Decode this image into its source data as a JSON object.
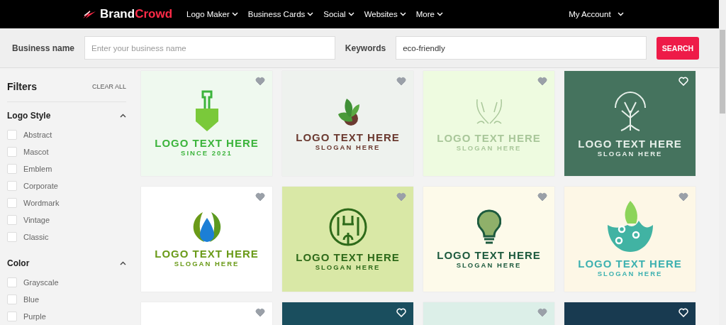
{
  "nav": {
    "brand": {
      "first": "Brand",
      "second": "Crowd"
    },
    "items": [
      {
        "label": "Logo Maker"
      },
      {
        "label": "Business Cards"
      },
      {
        "label": "Social"
      },
      {
        "label": "Websites"
      },
      {
        "label": "More"
      }
    ],
    "account": "My Account"
  },
  "search": {
    "business_label": "Business name",
    "business_placeholder": "Enter your business name",
    "keywords_label": "Keywords",
    "keywords_value": "eco-friendly",
    "button": "SEARCH"
  },
  "filters": {
    "title": "Filters",
    "clear": "CLEAR ALL",
    "sections": [
      {
        "title": "Logo Style",
        "expanded": true,
        "options": [
          {
            "label": "Abstract",
            "checked": false
          },
          {
            "label": "Mascot",
            "checked": false
          },
          {
            "label": "Emblem",
            "checked": false
          },
          {
            "label": "Corporate",
            "checked": false
          },
          {
            "label": "Wordmark",
            "checked": false
          },
          {
            "label": "Vintage",
            "checked": false
          },
          {
            "label": "Classic",
            "checked": false
          }
        ]
      },
      {
        "title": "Color",
        "expanded": true,
        "options": [
          {
            "label": "Grayscale",
            "checked": false
          },
          {
            "label": "Blue",
            "checked": false
          },
          {
            "label": "Purple",
            "checked": false
          }
        ]
      }
    ]
  },
  "cards": [
    {
      "kind": "light",
      "color": "#eff9ef",
      "logo": {
        "color": "#3cb43c",
        "text": "LOGO TEXT HERE",
        "slogan": "SINCE 2021"
      }
    },
    {
      "kind": "light",
      "color": "#eef2ee",
      "logo": {
        "color": "#6b3a30",
        "text": "LOGO TEXT HERE",
        "slogan": "SLOGAN HERE"
      }
    },
    {
      "kind": "light",
      "color": "#eefbe0",
      "logo": {
        "color": "#a9c79a",
        "text": "LOGO TEXT HERE",
        "slogan": "SLOGAN HERE"
      }
    },
    {
      "kind": "dark",
      "color": "#45735e",
      "logo": {
        "color": "#e6efe9",
        "text": "LOGO TEXT HERE",
        "slogan": "SLOGAN HERE"
      }
    },
    {
      "kind": "light",
      "color": "#ffffff",
      "logo": {
        "color": "#6a9a18",
        "text": "LOGO TEXT HERE",
        "slogan": "SLOGAN HERE"
      }
    },
    {
      "kind": "light",
      "color": "#d9e8a6",
      "logo": {
        "color": "#2e6a1a",
        "text": "LOGO TEXT HERE",
        "slogan": "SLOGAN HERE"
      }
    },
    {
      "kind": "light",
      "color": "#fdfaea",
      "logo": {
        "color": "#1d5a3e",
        "text": "LOGO TEXT HERE",
        "slogan": "SLOGAN HERE"
      }
    },
    {
      "kind": "light",
      "color": "#fdf7e6",
      "logo": {
        "color": "#3db1b0",
        "text": "LOGO TEXT HERE",
        "slogan": "SLOGAN HERE"
      }
    },
    {
      "kind": "light",
      "color": "#ffffff"
    },
    {
      "kind": "dark",
      "color": "#1a4e5e"
    },
    {
      "kind": "light",
      "color": "#dcefe8"
    },
    {
      "kind": "dark",
      "color": "#183a50"
    }
  ]
}
